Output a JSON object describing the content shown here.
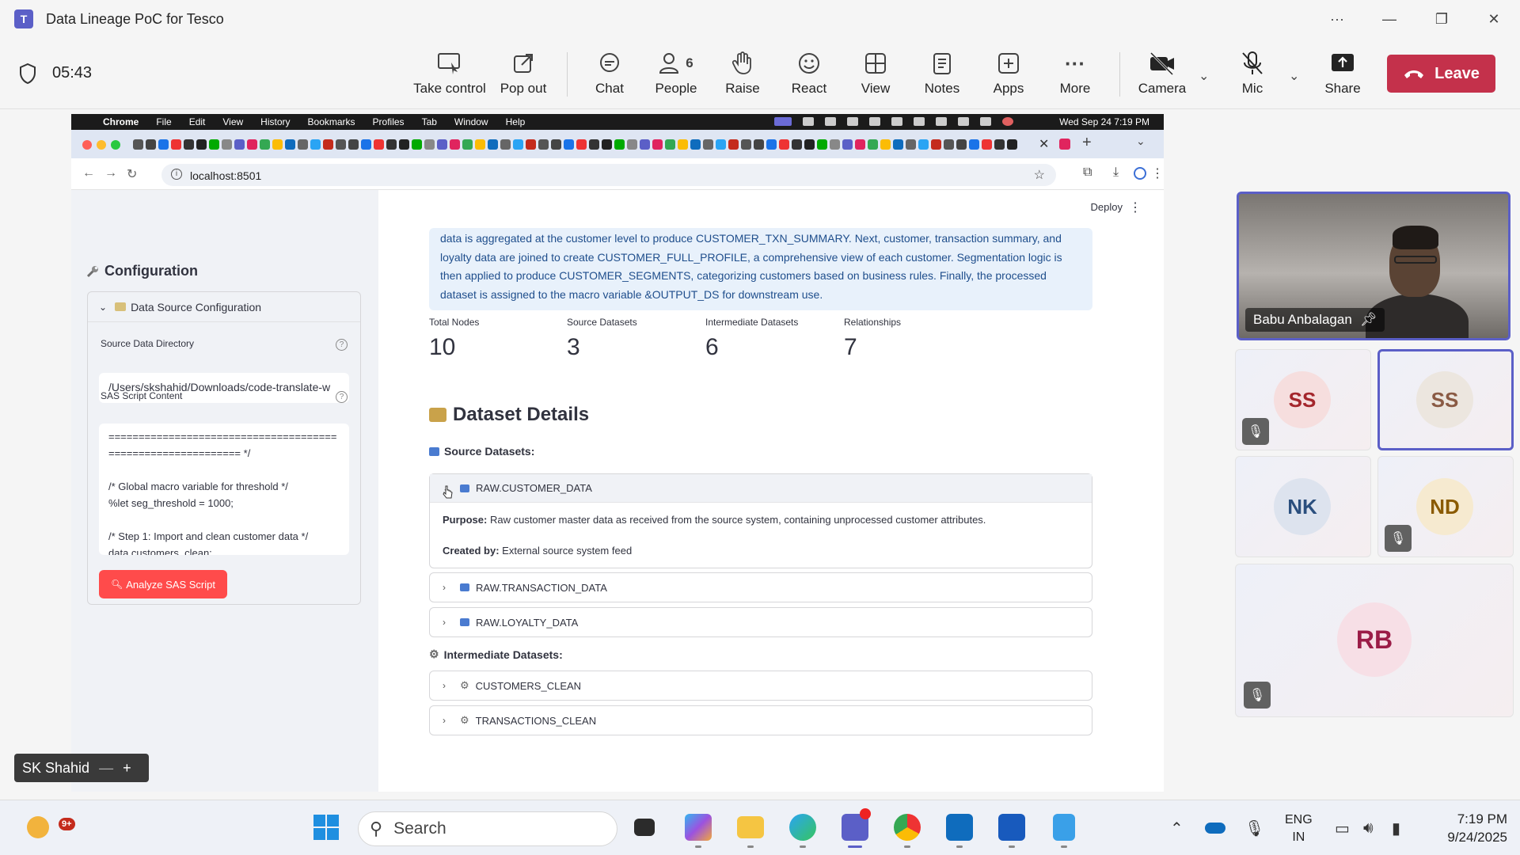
{
  "window": {
    "title": "Data Lineage PoC for Tesco",
    "more": "···",
    "minimize": "—",
    "maximize": "❐",
    "close": "✕"
  },
  "meeting": {
    "timer": "05:43",
    "toolbar": [
      {
        "id": "take-control",
        "label": "Take control",
        "icon": "take-control-icon"
      },
      {
        "id": "pop-out",
        "label": "Pop out",
        "icon": "pop-out-icon"
      },
      {
        "id": "chat",
        "label": "Chat",
        "icon": "chat-icon"
      },
      {
        "id": "people",
        "label": "People",
        "count": "6",
        "icon": "people-icon"
      },
      {
        "id": "raise",
        "label": "Raise",
        "icon": "raise-hand-icon"
      },
      {
        "id": "react",
        "label": "React",
        "icon": "react-icon"
      },
      {
        "id": "view",
        "label": "View",
        "icon": "view-icon"
      },
      {
        "id": "notes",
        "label": "Notes",
        "icon": "notes-icon"
      },
      {
        "id": "apps",
        "label": "Apps",
        "icon": "apps-icon"
      },
      {
        "id": "more",
        "label": "More",
        "icon": "more-icon"
      },
      {
        "id": "camera",
        "label": "Camera",
        "icon": "camera-off-icon"
      },
      {
        "id": "mic",
        "label": "Mic",
        "icon": "mic-off-icon"
      },
      {
        "id": "share",
        "label": "Share",
        "icon": "share-icon"
      }
    ],
    "leave_label": "Leave",
    "leave_color": "#c4314b"
  },
  "mac_menu": {
    "app": "Chrome",
    "items": [
      "File",
      "Edit",
      "View",
      "History",
      "Bookmarks",
      "Profiles",
      "Tab",
      "Window",
      "Help"
    ],
    "clock": "Wed Sep 24  7:19 PM"
  },
  "browser": {
    "url": "localhost:8501"
  },
  "app": {
    "deploy": "Deploy",
    "sidebar": {
      "heading": "Configuration",
      "expander": "Data Source Configuration",
      "dir_label": "Source Data Directory",
      "dir_value": "/Users/skshahid/Downloads/code-translate-w",
      "script_label": "SAS Script Content",
      "script_lines": [
        "======================================",
        "====================== */",
        "",
        "/* Global macro variable for threshold */",
        "%let seg_threshold = 1000;",
        "",
        "/* Step 1: Import and clean customer data */",
        "data customers_clean;"
      ],
      "analyze_label": "Analyze SAS Script",
      "accent": "#ff4b4b"
    },
    "summary": [
      "data is aggregated at the customer level to produce CUSTOMER_TXN_SUMMARY. Next, customer, transaction summary, and",
      "loyalty data are joined to create CUSTOMER_FULL_PROFILE, a comprehensive view of each customer. Segmentation logic is",
      "then applied to produce CUSTOMER_SEGMENTS, categorizing customers based on business rules. Finally, the processed",
      "dataset is assigned to the macro variable &OUTPUT_DS for downstream use."
    ],
    "metrics": [
      {
        "label": "Total Nodes",
        "value": "10"
      },
      {
        "label": "Source Datasets",
        "value": "3"
      },
      {
        "label": "Intermediate Datasets",
        "value": "6"
      },
      {
        "label": "Relationships",
        "value": "7"
      }
    ],
    "details_heading": "Dataset Details",
    "source_heading": "Source Datasets:",
    "intermediate_heading": "Intermediate Datasets:",
    "source_datasets": [
      {
        "name": "RAW.CUSTOMER_DATA",
        "expanded": true,
        "purpose_label": "Purpose:",
        "purpose": "Raw customer master data as received from the source system, containing unprocessed customer attributes.",
        "created_label": "Created by:",
        "created": "External source system feed"
      },
      {
        "name": "RAW.TRANSACTION_DATA",
        "expanded": false
      },
      {
        "name": "RAW.LOYALTY_DATA",
        "expanded": false
      }
    ],
    "intermediate_datasets": [
      {
        "name": "CUSTOMERS_CLEAN"
      },
      {
        "name": "TRANSACTIONS_CLEAN"
      }
    ]
  },
  "participants": {
    "presenter": "Babu Anbalagan",
    "tiles": [
      {
        "initials": "SS",
        "muted": true,
        "bg": "#f6dede",
        "fg": "#a4262c"
      },
      {
        "initials": "SS",
        "muted": false,
        "selected": true,
        "bg": "#ece6df",
        "fg": "#8a5a44"
      },
      {
        "initials": "NK",
        "muted": false,
        "bg": "#dde3ee",
        "fg": "#2b4f7e"
      },
      {
        "initials": "ND",
        "muted": true,
        "bg": "#f6ead0",
        "fg": "#8a5a00"
      },
      {
        "initials": "RB",
        "muted": true,
        "bg": "#f7dfe6",
        "fg": "#9b1c47"
      }
    ],
    "self": "SK Shahid"
  },
  "taskbar": {
    "search_placeholder": "Search",
    "widgets_badge": "9+",
    "lang_top": "ENG",
    "lang_bottom": "IN",
    "time": "7:19 PM",
    "date": "9/24/2025"
  }
}
